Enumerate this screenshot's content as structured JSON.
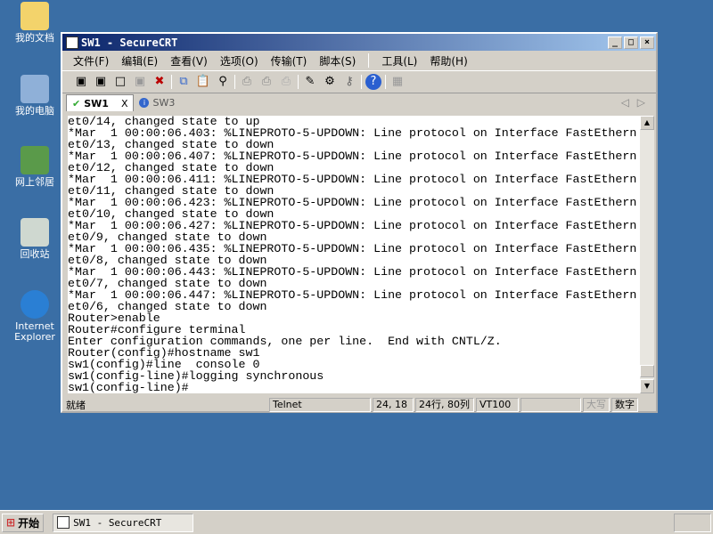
{
  "desktop": {
    "icons": [
      "我的文档",
      "我的电脑",
      "网上邻居",
      "回收站",
      "Internet Explorer"
    ]
  },
  "window": {
    "title": "SW1 - SecureCRT",
    "menu": [
      "文件(F)",
      "编辑(E)",
      "查看(V)",
      "选项(O)",
      "传输(T)",
      "脚本(S)",
      "工具(L)",
      "帮助(H)"
    ],
    "tabs": [
      {
        "label": "SW1",
        "close": "X"
      },
      {
        "label": "SW3"
      }
    ],
    "terminal_lines": [
      "et0/14, changed state to up",
      "*Mar  1 00:00:06.403: %LINEPROTO-5-UPDOWN: Line protocol on Interface FastEthern",
      "et0/13, changed state to down",
      "*Mar  1 00:00:06.407: %LINEPROTO-5-UPDOWN: Line protocol on Interface FastEthern",
      "et0/12, changed state to down",
      "*Mar  1 00:00:06.411: %LINEPROTO-5-UPDOWN: Line protocol on Interface FastEthern",
      "et0/11, changed state to down",
      "*Mar  1 00:00:06.423: %LINEPROTO-5-UPDOWN: Line protocol on Interface FastEthern",
      "et0/10, changed state to down",
      "*Mar  1 00:00:06.427: %LINEPROTO-5-UPDOWN: Line protocol on Interface FastEthern",
      "et0/9, changed state to down",
      "*Mar  1 00:00:06.435: %LINEPROTO-5-UPDOWN: Line protocol on Interface FastEthern",
      "et0/8, changed state to down",
      "*Mar  1 00:00:06.443: %LINEPROTO-5-UPDOWN: Line protocol on Interface FastEthern",
      "et0/7, changed state to down",
      "*Mar  1 00:00:06.447: %LINEPROTO-5-UPDOWN: Line protocol on Interface FastEthern",
      "et0/6, changed state to down",
      "Router>enable",
      "Router#configure terminal",
      "Enter configuration commands, one per line.  End with CNTL/Z.",
      "Router(config)#hostname sw1",
      "sw1(config)#line  console 0",
      "sw1(config-line)#logging synchronous",
      "sw1(config-line)#"
    ],
    "status": {
      "ready": "就绪",
      "protocol": "Telnet",
      "cursor": "24, 18",
      "size": "24行, 80列",
      "emulation": "VT100",
      "caps": "大写",
      "num": "数字"
    }
  },
  "taskbar": {
    "start": "开始",
    "task": "SW1 - SecureCRT"
  }
}
